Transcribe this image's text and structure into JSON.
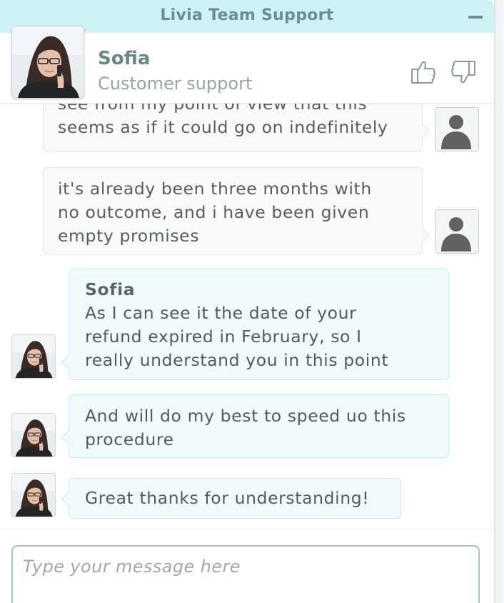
{
  "window": {
    "title": "Livia Team Support"
  },
  "agent": {
    "name": "Sofia",
    "role": "Customer support"
  },
  "messages": [
    {
      "from": "user",
      "text": "see from my point of view that this\nseems as if it could go on indefinitely"
    },
    {
      "from": "user",
      "text": "it's already been three months with\nno outcome, and i have been given\nempty promises"
    },
    {
      "from": "agent",
      "sender": "Sofia",
      "text": "As I can see it the date of your\nrefund expired in February, so I\nreally understand you in this point"
    },
    {
      "from": "agent",
      "text": "And will do my best to speed uo this\nprocedure"
    },
    {
      "from": "agent",
      "text": "Great thanks for understanding!"
    }
  ],
  "composer": {
    "placeholder": "Type your message here"
  },
  "icons": {
    "minimize": "minimize-icon",
    "thumbs_up": "thumbs-up-icon",
    "thumbs_down": "thumbs-down-icon",
    "user_avatar": "user-silhouette-icon"
  },
  "colors": {
    "header_bg": "#cdf3f6",
    "title_text": "#6d8e90",
    "agent_bubble": "#f1fafc",
    "user_bubble": "#fafafa"
  }
}
